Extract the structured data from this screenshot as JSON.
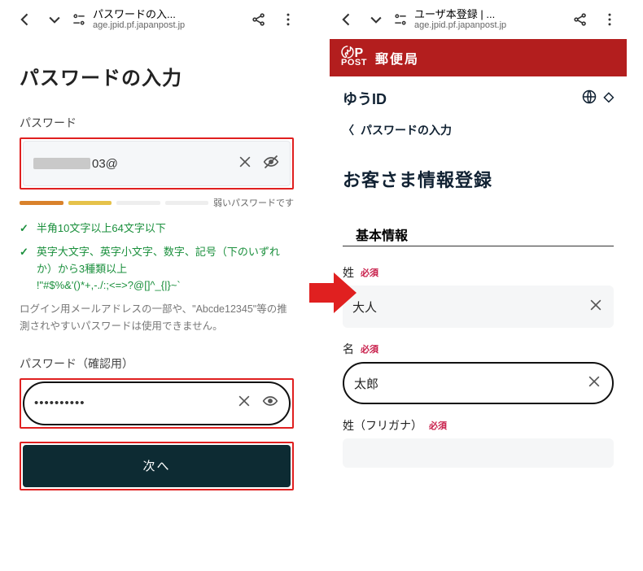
{
  "left": {
    "browser": {
      "title": "パスワードの入...",
      "host": "age.jpid.pf.japanpost.jp"
    },
    "page_title": "パスワードの入力",
    "password_label": "パスワード",
    "password_suffix": "03@",
    "strength_text": "弱いパスワードです",
    "rules": [
      "半角10文字以上64文字以下",
      "英字大文字、英字小文字、数字、記号（下のいずれか）から3種類以上\n!\"#$%&'()*+,-./:;<=>?@[]^_{|}~`"
    ],
    "note": "ログイン用メールアドレスの一部や、\"Abcde12345\"等の推測されやすいパスワードは使用できません。",
    "confirm_label": "パスワード（確認用）",
    "confirm_value": "••••••••••",
    "next_label": "次へ"
  },
  "right": {
    "browser": {
      "title": "ユーザ本登録 | ...",
      "host": "age.jpid.pf.japanpost.jp"
    },
    "brand": "郵便局",
    "service": "ゆうID",
    "breadcrumb": "パスワードの入力",
    "section_title": "お客さま情報登録",
    "sub_section": "基本情報",
    "required": "必須",
    "fields": {
      "sei": {
        "label": "姓",
        "value": "大人"
      },
      "mei": {
        "label": "名",
        "value": "太郎"
      },
      "sei_kana": {
        "label": "姓（フリガナ）",
        "value": ""
      }
    }
  }
}
